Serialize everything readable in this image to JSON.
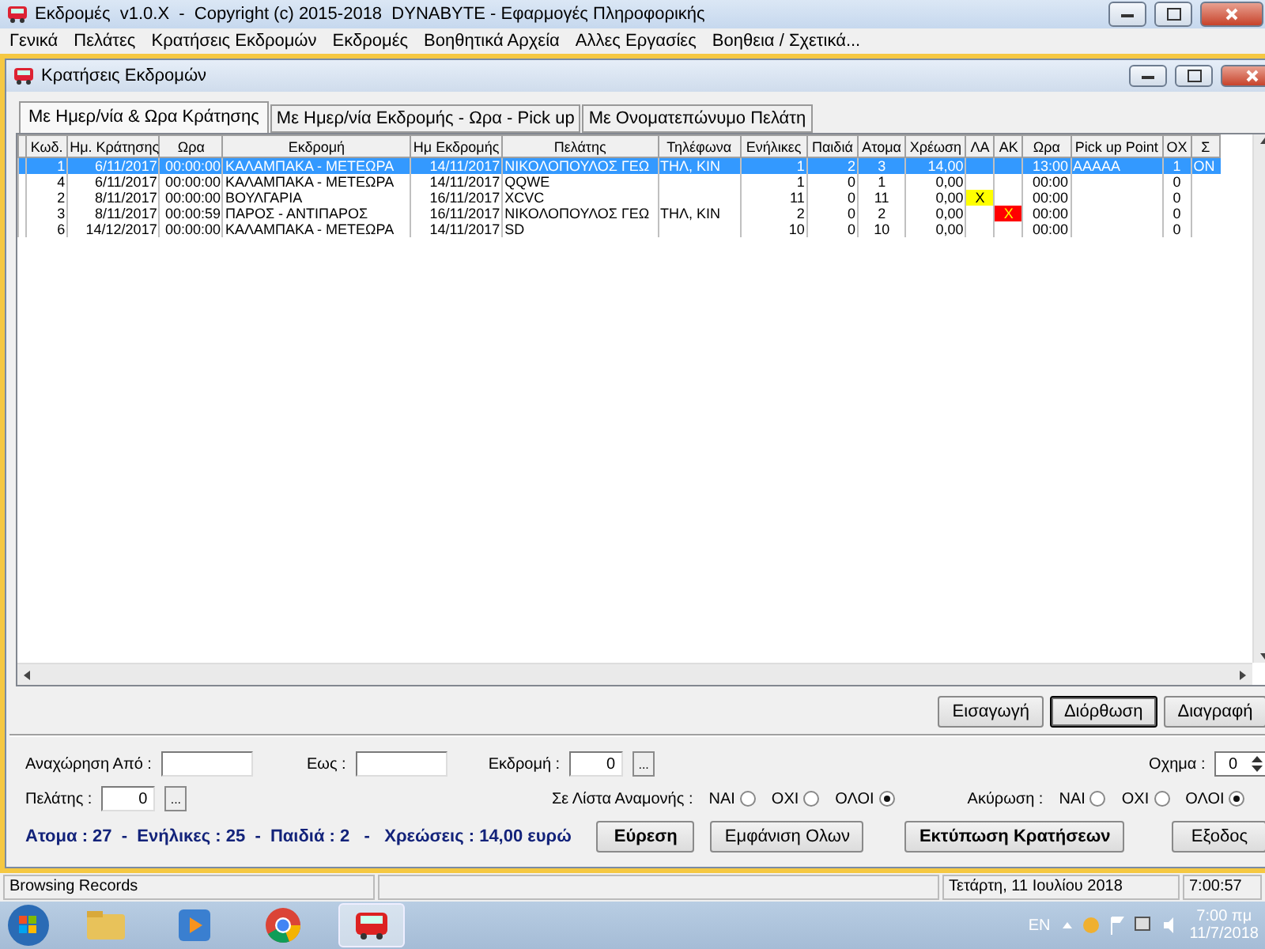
{
  "app_title": "Εκδρομές  v1.0.X  -  Copyright (c) 2015-2018  DYNABYTE - Εφαρμογές Πληροφορικής",
  "menu": [
    "Γενικά",
    "Πελάτες",
    "Κρατήσεις Εκδρομών",
    "Εκδρομές",
    "Βοηθητικά Αρχεία",
    "Αλλες Εργασίες",
    "Βοηθεια / Σχετικά..."
  ],
  "child_title": "Κρατήσεις Εκδρομών",
  "tabs": [
    {
      "label": "Με Ημερ/νία & Ωρα Κράτησης",
      "selected": true
    },
    {
      "label": "Με Ημερ/νία Εκδρομής - Ωρα - Pick up",
      "selected": false
    },
    {
      "label": "Με Ονοματεπώνυμο Πελάτη",
      "selected": false
    }
  ],
  "table": {
    "columns": [
      "Κωδ.",
      "Ημ. Κράτησης",
      "Ωρα",
      "Εκδρομή",
      "Ημ Εκδρομής",
      "Πελάτης",
      "Τηλέφωνα",
      "Ενήλικες",
      "Παιδιά",
      "Ατομα",
      "Χρέωση",
      "ΛΑ",
      "ΑΚ",
      "Ωρα",
      "Pick up Point",
      "ΟΧ",
      "Σ"
    ],
    "rows": [
      {
        "selected": true,
        "cells": [
          "1",
          "6/11/2017",
          "00:00:00",
          "ΚΑΛΑΜΠΑΚΑ - ΜΕΤΕΩΡΑ",
          "14/11/2017",
          "ΝΙΚΟΛΟΠΟΥΛΟΣ ΓΕΩ",
          "ΤΗΛ, ΚΙΝ",
          "1",
          "2",
          "3",
          "14,00",
          "",
          "",
          "13:00",
          "AAAAA",
          "1",
          "ON"
        ]
      },
      {
        "selected": false,
        "cells": [
          "4",
          "6/11/2017",
          "00:00:00",
          "ΚΑΛΑΜΠΑΚΑ - ΜΕΤΕΩΡΑ",
          "14/11/2017",
          "QQWE",
          "",
          "1",
          "0",
          "1",
          "0,00",
          "",
          "",
          "00:00",
          "",
          "0",
          ""
        ]
      },
      {
        "selected": false,
        "cells": [
          "2",
          "8/11/2017",
          "00:00:00",
          "ΒΟΥΛΓΑΡΙΑ",
          "16/11/2017",
          "XCVC",
          "",
          "11",
          "0",
          "11",
          "0,00",
          {
            "text": "X",
            "color": "#ffff00"
          },
          "",
          "00:00",
          "",
          "0",
          ""
        ]
      },
      {
        "selected": false,
        "cells": [
          "3",
          "8/11/2017",
          "00:00:59",
          "ΠΑΡΟΣ - ΑΝΤΙΠΑΡΟΣ",
          "16/11/2017",
          "ΝΙΚΟΛΟΠΟΥΛΟΣ ΓΕΩ",
          "ΤΗΛ, ΚΙΝ",
          "2",
          "0",
          "2",
          "0,00",
          "",
          {
            "text": "X",
            "color": "#ff0000"
          },
          "00:00",
          "",
          "0",
          ""
        ]
      },
      {
        "selected": false,
        "cells": [
          "6",
          "14/12/2017",
          "00:00:00",
          "ΚΑΛΑΜΠΑΚΑ - ΜΕΤΕΩΡΑ",
          "14/11/2017",
          "SD",
          "",
          "10",
          "0",
          "10",
          "0,00",
          "",
          "",
          "00:00",
          "",
          "0",
          ""
        ]
      }
    ]
  },
  "grid_buttons": [
    {
      "label": "Εισαγωγή",
      "selected": false
    },
    {
      "label": "Διόρθωση",
      "selected": true
    },
    {
      "label": "Διαγραφή",
      "selected": false
    }
  ],
  "filters": {
    "departure_from": "Αναχώρηση Από :",
    "until": "Εως :",
    "excursion": {
      "label": "Εκδρομή :",
      "value": "0",
      "browse": "..."
    },
    "vehicle": {
      "label": "Οχημα :",
      "value": "0"
    },
    "customer": {
      "label": "Πελάτης :",
      "value": "0",
      "browse": "..."
    },
    "radio_groups": [
      {
        "label": "Σε Λίστα Αναμονής :",
        "options": [
          {
            "label": "ΝΑΙ",
            "selected": false
          },
          {
            "label": "ΟΧΙ",
            "selected": false
          },
          {
            "label": "ΟΛΟΙ",
            "selected": true
          }
        ]
      },
      {
        "label": "Ακύρωση :",
        "options": [
          {
            "label": "ΝΑΙ",
            "selected": false
          },
          {
            "label": "ΟΧΙ",
            "selected": false
          },
          {
            "label": "ΟΛΟΙ",
            "selected": true
          }
        ]
      }
    ]
  },
  "summary": "Ατομα : 27  -  Ενήλικες : 25  -  Παιδιά : 2   -   Χρεώσεις : 14,00 ευρώ",
  "actions": [
    {
      "label": "Εύρεση",
      "bold": true
    },
    {
      "label": "Εμφάνιση Ολων",
      "bold": false
    },
    {
      "label": "Εκτύπωση Κρατήσεων",
      "bold": true
    },
    {
      "label": "Εξοδος",
      "bold": false
    }
  ],
  "status_bar": {
    "message": "Browsing Records",
    "date": "Τετάρτη, 11 Ιουλίου 2018",
    "time": "7:00:57"
  },
  "taskbar": {
    "language": "EN",
    "time": "7:00 πμ",
    "date": "11/7/2018"
  }
}
